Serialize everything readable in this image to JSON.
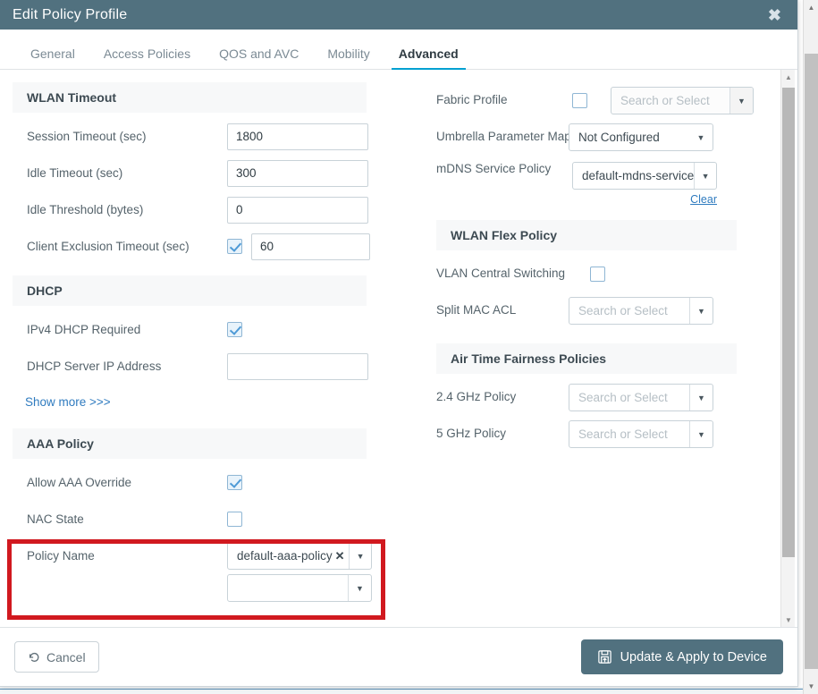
{
  "window": {
    "title": "Edit Policy Profile",
    "close_icon": "close-icon",
    "header_bg": "#51717f"
  },
  "tabs": [
    {
      "label": "General",
      "active": false
    },
    {
      "label": "Access Policies",
      "active": false
    },
    {
      "label": "QOS and AVC",
      "active": false
    },
    {
      "label": "Mobility",
      "active": false
    },
    {
      "label": "Advanced",
      "active": true
    }
  ],
  "accent_color": "#00a0d1",
  "highlight_color": "#d1191f",
  "left_column": {
    "wlan_timeout": {
      "heading": "WLAN Timeout",
      "fields": [
        {
          "label": "Session Timeout (sec)",
          "value": "1800"
        },
        {
          "label": "Idle Timeout (sec)",
          "value": "300"
        },
        {
          "label": "Idle Threshold (bytes)",
          "value": "0"
        }
      ],
      "client_exclusion": {
        "label": "Client Exclusion Timeout (sec)",
        "checked": true,
        "value": "60"
      }
    },
    "dhcp": {
      "heading": "DHCP",
      "ipv4_required": {
        "label": "IPv4 DHCP Required",
        "checked": true
      },
      "server_ip": {
        "label": "DHCP Server IP Address",
        "value": "",
        "placeholder": ""
      }
    },
    "show_more": "Show more >>>",
    "aaa_policy": {
      "heading": "AAA Policy",
      "highlighted": true,
      "allow_override": {
        "label": "Allow AAA Override",
        "checked": true
      },
      "nac_state": {
        "label": "NAC State",
        "checked": false
      },
      "policy_name": {
        "label": "Policy Name",
        "value": "default-aaa-policy",
        "remove_icon": "tag-remove-icon",
        "dropdown_icon": "chevron-down-icon"
      },
      "partial_row": {
        "value": "",
        "placeholder": ""
      }
    }
  },
  "right_column": {
    "fabric_profile": {
      "label": "Fabric Profile",
      "checked": false,
      "placeholder": "Search or Select",
      "value": ""
    },
    "umbrella_parameter_map": {
      "label": "Umbrella Parameter Map",
      "value": "Not Configured"
    },
    "mdns_service_policy": {
      "label": "mDNS Service Policy",
      "value": "default-mdns-service",
      "clear_label": "Clear"
    },
    "wlan_flex_policy": {
      "heading": "WLAN Flex Policy",
      "vlan_central_switching": {
        "label": "VLAN Central Switching",
        "checked": false
      },
      "split_mac_acl": {
        "label": "Split MAC ACL",
        "value": "",
        "placeholder": "Search or Select"
      }
    },
    "air_time_fairness": {
      "heading": "Air Time Fairness Policies",
      "policies": [
        {
          "label": "2.4 GHz Policy",
          "value": "",
          "placeholder": "Search or Select"
        },
        {
          "label": "5 GHz Policy",
          "value": "",
          "placeholder": "Search or Select"
        }
      ]
    }
  },
  "footer": {
    "cancel_label": "Cancel",
    "cancel_icon": "undo-icon",
    "update_label": "Update & Apply to Device",
    "update_icon": "save-icon"
  },
  "scrollbars": {
    "inner_up_icon": "caret-up-icon",
    "inner_down_icon": "caret-down-icon",
    "outer_up_icon": "caret-up-icon",
    "outer_down_icon": "caret-down-icon"
  }
}
